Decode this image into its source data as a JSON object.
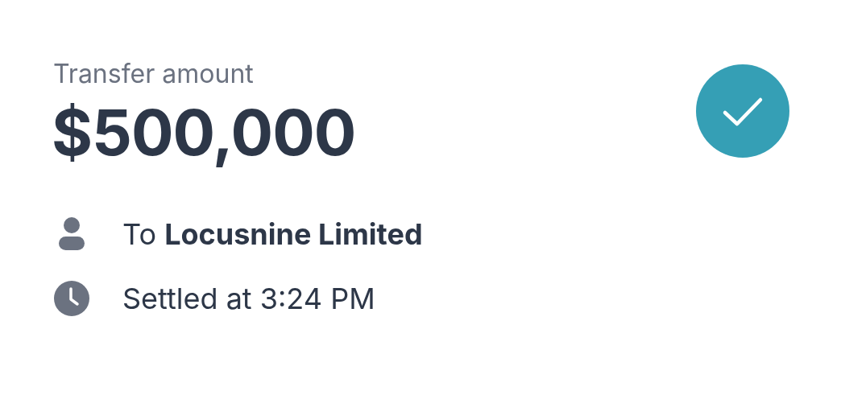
{
  "label": "Transfer amount",
  "amount": "$500,000",
  "status": {
    "kind": "success"
  },
  "details": [
    {
      "kind": "person",
      "text": "To **Locusnine Limited**"
    },
    {
      "kind": "clock",
      "text": "Settled at 3:24 PM"
    }
  ]
}
